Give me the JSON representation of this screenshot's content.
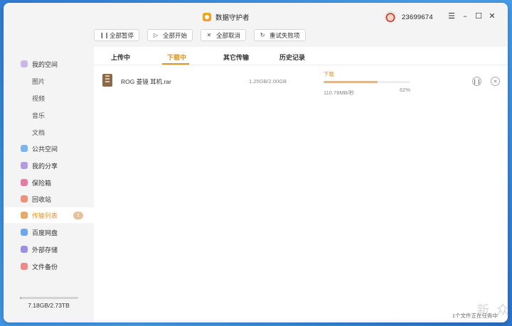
{
  "app": {
    "title": "数据守护者",
    "username": "23699674",
    "controls": {
      "menu": "☰",
      "minimize": "–",
      "maximize": "☐",
      "close": "✕"
    }
  },
  "toolbar": {
    "pause_all": "全部暂停",
    "start_all": "全部开始",
    "cancel_all": "全部取消",
    "retry_failed": "重试失败项",
    "icons": {
      "pause": "❙❙",
      "play": "▷",
      "cancel": "✕",
      "retry": "↻"
    }
  },
  "sidebar": {
    "items": [
      {
        "label": "我的空间",
        "icon": "cloud-icon",
        "color": "#c9b8e8"
      },
      {
        "label": "图片"
      },
      {
        "label": "视频"
      },
      {
        "label": "音乐"
      },
      {
        "label": "文档"
      },
      {
        "label": "公共空间",
        "icon": "send-icon",
        "color": "#7cb4f0"
      },
      {
        "label": "我的分享",
        "icon": "share-icon",
        "color": "#b39be0"
      },
      {
        "label": "保险箱",
        "icon": "safe-icon",
        "color": "#e57aa4"
      },
      {
        "label": "回收站",
        "icon": "trash-icon",
        "color": "#f0907a"
      },
      {
        "label": "传输列表",
        "icon": "transfer-icon",
        "color": "#e6a96b",
        "badge": "1"
      },
      {
        "label": "百度网盘",
        "icon": "baidu-icon",
        "color": "#6ba8ef"
      },
      {
        "label": "外部存储",
        "icon": "usb-icon",
        "color": "#9c8fe6"
      },
      {
        "label": "文件备份",
        "icon": "backup-icon",
        "color": "#f08a8a"
      }
    ],
    "storage": {
      "text": "7.18GB/2.73TB",
      "used_fraction": 0.003
    }
  },
  "tabs": [
    "上传中",
    "下载中",
    "其它传输",
    "历史记录"
  ],
  "active_tab": 1,
  "transfers": [
    {
      "file_name": "ROG 菱镜 耳机.rar",
      "size": "1.25GB/2.00GB",
      "status": "下载",
      "speed": "110.78MB/秒",
      "percent": "62%",
      "progress": 0.62
    }
  ],
  "footer": {
    "status": "1个文件正在任务中"
  },
  "watermark": "新 众"
}
